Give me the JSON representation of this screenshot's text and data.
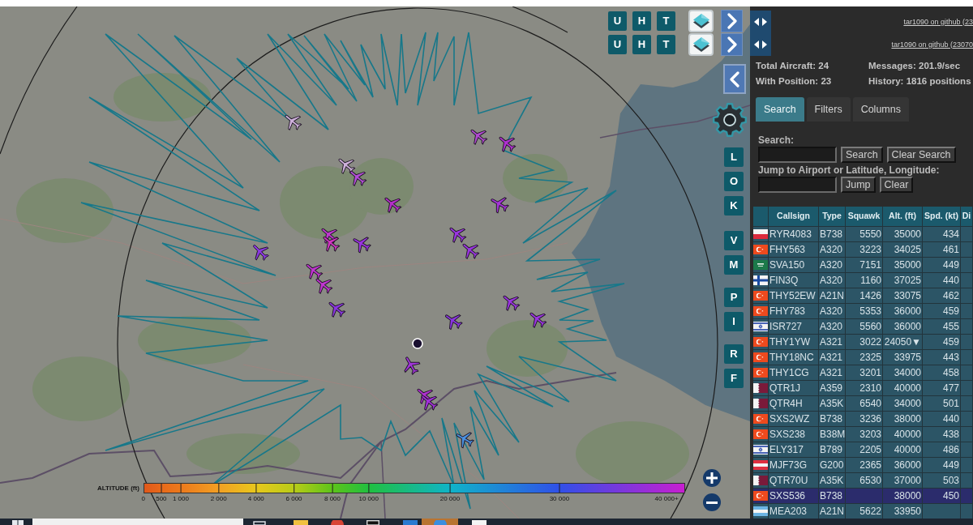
{
  "map": {
    "top_button_rows": [
      {
        "labels": [
          "U",
          "H",
          "T"
        ]
      },
      {
        "labels": [
          "U",
          "H",
          "T"
        ]
      }
    ],
    "side_button_groups": [
      {
        "labels": [
          "L",
          "O",
          "K"
        ]
      },
      {
        "labels": [
          "V",
          "M"
        ]
      },
      {
        "labels": [
          "P",
          "I"
        ]
      },
      {
        "labels": [
          "R",
          "F"
        ]
      }
    ],
    "aircraft_markers": [
      {
        "color": "#cdb0da"
      },
      {
        "color": "#cdb0da"
      },
      {
        "color": "#b44fd8"
      },
      {
        "color": "#b42fc8"
      },
      {
        "color": "#b04ad0"
      },
      {
        "color": "#b030d0"
      },
      {
        "color": "#a535d8"
      },
      {
        "color": "#8a38e0"
      },
      {
        "color": "#c038d0"
      },
      {
        "color": "#d035c0"
      },
      {
        "color": "#9a35e0"
      },
      {
        "color": "#9a35e0"
      },
      {
        "color": "#9a35e0"
      },
      {
        "color": "#c035d0"
      },
      {
        "color": "#c035d0"
      },
      {
        "color": "#8a35e0"
      },
      {
        "color": "#9a35e0"
      },
      {
        "color": "#9a35e0"
      },
      {
        "color": "#8a35e0"
      },
      {
        "color": "#a035d8"
      },
      {
        "color": "#b030d0"
      },
      {
        "color": "#a030d8"
      },
      {
        "color": "#4a90e0"
      }
    ],
    "altitude_legend": {
      "title": "ALTITUDE (ft)",
      "ticks": [
        "0",
        "500",
        "1 000",
        "2 000",
        "4 000",
        "6 000",
        "8 000",
        "10 000",
        "20 000",
        "30 000",
        "40 000+"
      ]
    }
  },
  "sidebar": {
    "header_rows": [
      {
        "link": "tar1090 on github (23"
      },
      {
        "link": "tar1090 on github (23070"
      }
    ],
    "stats": [
      "Total Aircraft: 24",
      "Messages: 201.9/sec",
      "With Position: 23",
      "History: 1816 positions"
    ],
    "tabs": [
      {
        "label": "Search",
        "selected": true
      },
      {
        "label": "Filters",
        "selected": false
      },
      {
        "label": "Columns",
        "selected": false
      }
    ],
    "search": {
      "label": "Search:",
      "buttons": [
        "Search",
        "Clear Search"
      ]
    },
    "jump": {
      "label": "Jump to Airport or Latitude, Longitude:",
      "buttons": [
        "Jump",
        "Clear"
      ]
    },
    "table": {
      "columns": [
        "Callsign",
        "Type",
        "Squawk",
        "Alt. (ft)",
        "Spd. (kt)",
        "Di"
      ],
      "rows": [
        {
          "kind": "poland",
          "callsign": "RYR4083",
          "type": "B738",
          "squawk": "5550",
          "altitude": "35000",
          "speed": "434",
          "selected": false
        },
        {
          "kind": "turkey",
          "callsign": "FHY563",
          "type": "A320",
          "squawk": "3223",
          "altitude": "34025",
          "speed": "461",
          "selected": false
        },
        {
          "kind": "saudi",
          "callsign": "SVA150",
          "type": "A320",
          "squawk": "7151",
          "altitude": "35000",
          "speed": "449",
          "selected": false
        },
        {
          "kind": "finland",
          "callsign": "FIN3Q",
          "type": "A320",
          "squawk": "1160",
          "altitude": "37025",
          "speed": "440",
          "selected": false
        },
        {
          "kind": "turkey",
          "callsign": "THY52EW",
          "type": "A21N",
          "squawk": "1426",
          "altitude": "33075",
          "speed": "462",
          "selected": false
        },
        {
          "kind": "turkey",
          "callsign": "FHY783",
          "type": "A320",
          "squawk": "5353",
          "altitude": "36000",
          "speed": "459",
          "selected": false
        },
        {
          "kind": "israel",
          "callsign": "ISR727",
          "type": "A320",
          "squawk": "5560",
          "altitude": "36000",
          "speed": "455",
          "selected": false
        },
        {
          "kind": "turkey",
          "callsign": "THY1YW",
          "type": "A321",
          "squawk": "3022",
          "altitude": "24050▼",
          "speed": "459",
          "selected": false
        },
        {
          "kind": "turkey",
          "callsign": "THY18NC",
          "type": "A321",
          "squawk": "2325",
          "altitude": "33975",
          "speed": "443",
          "selected": false
        },
        {
          "kind": "turkey",
          "callsign": "THY1CG",
          "type": "A321",
          "squawk": "3201",
          "altitude": "34000",
          "speed": "458",
          "selected": false
        },
        {
          "kind": "qatar",
          "callsign": "QTR1J",
          "type": "A359",
          "squawk": "2310",
          "altitude": "40000",
          "speed": "477",
          "selected": false
        },
        {
          "kind": "qatar",
          "callsign": "QTR4H",
          "type": "A35K",
          "squawk": "6540",
          "altitude": "34000",
          "speed": "501",
          "selected": false
        },
        {
          "kind": "turkey",
          "callsign": "SXS2WZ",
          "type": "B738",
          "squawk": "3236",
          "altitude": "38000",
          "speed": "440",
          "selected": false
        },
        {
          "kind": "turkey",
          "callsign": "SXS238",
          "type": "B38M",
          "squawk": "3203",
          "altitude": "40000",
          "speed": "438",
          "selected": false
        },
        {
          "kind": "israel",
          "callsign": "ELY317",
          "type": "B789",
          "squawk": "2205",
          "altitude": "40000",
          "speed": "486",
          "selected": false
        },
        {
          "kind": "austria",
          "callsign": "MJF73G",
          "type": "G200",
          "squawk": "2365",
          "altitude": "36000",
          "speed": "449",
          "selected": false
        },
        {
          "kind": "qatar",
          "callsign": "QTR70U",
          "type": "A35K",
          "squawk": "6530",
          "altitude": "37000",
          "speed": "503",
          "selected": false
        },
        {
          "kind": "turkey",
          "callsign": "SXS536",
          "type": "B738",
          "altitude": "38000",
          "speed": "450",
          "selected": true
        },
        {
          "kind": "skyblue",
          "callsign": "MEA203",
          "type": "A21N",
          "squawk": "5622",
          "altitude": "33950",
          "selected": false
        }
      ]
    }
  }
}
